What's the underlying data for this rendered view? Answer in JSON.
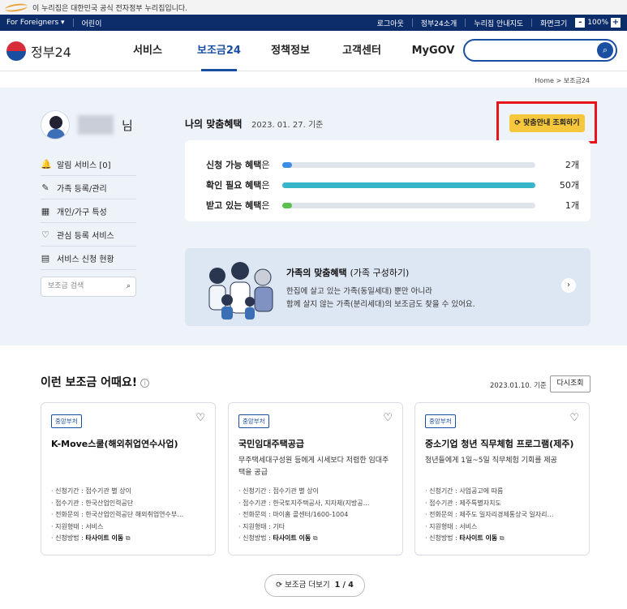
{
  "gov_banner": {
    "text": "이 누리집은 대한민국 공식 전자정부 누리집입니다."
  },
  "utility": {
    "language": "For Foreigners",
    "easy_mode": "어린이",
    "logout": "로그아웃",
    "about": "정부24소개",
    "sitemap": "누리집 안내지도",
    "zoom_label": "화면크기",
    "zoom_minus": "-",
    "zoom_value": "100%",
    "zoom_plus": "+"
  },
  "header": {
    "logo_text": "정부24",
    "nav": [
      "서비스",
      "보조금24",
      "정책정보",
      "고객센터",
      "MyGOV"
    ],
    "active_nav": "보조금24",
    "search_icon": "search-icon"
  },
  "breadcrumb": "Home  >  보조금24",
  "profile": {
    "suffix": "님"
  },
  "sidemenu": [
    {
      "icon": "bell-icon",
      "glyph": "🔔",
      "label": "알림 서비스 [0]"
    },
    {
      "icon": "pencil-icon",
      "glyph": "✎",
      "label": "가족 등록/관리"
    },
    {
      "icon": "calendar-icon",
      "glyph": "▦",
      "label": "개인/가구 특성"
    },
    {
      "icon": "heart-icon",
      "glyph": "♡",
      "label": "관심 등록 서비스"
    },
    {
      "icon": "document-icon",
      "glyph": "▤",
      "label": "서비스 신청 현황"
    }
  ],
  "side_search": {
    "placeholder": "보조금 검색"
  },
  "my_benefits": {
    "title": "나의 맞춤혜택",
    "date": "2023. 01. 27. 기준",
    "refresh_label": "맞춤안내 조회하기",
    "stats": [
      {
        "label": "신청 가능 혜택",
        "suffix": "은",
        "count": "2개",
        "value": 2,
        "max": 50,
        "color": "#3b8ee4"
      },
      {
        "label": "확인 필요 혜택",
        "suffix": "은",
        "count": "50개",
        "value": 50,
        "max": 50,
        "color": "#38b6c9"
      },
      {
        "label": "받고 있는 혜택",
        "suffix": "은",
        "count": "1개",
        "value": 1,
        "max": 50,
        "color": "#5cbf4e"
      }
    ]
  },
  "family": {
    "title": "가족의 맞춤혜택",
    "subtitle": "(가족 구성하기)",
    "desc_line1": "한집에 살고 있는 가족(동일세대) 뿐만 아니라",
    "desc_line2": "함께 살지 않는 가족(분리세대)의 보조금도 찾을 수 있어요."
  },
  "recommend": {
    "title": "이런 보조금 어때요!",
    "date": "2023.01.10. 기준",
    "reload": "다시조회",
    "cards": [
      {
        "badge": "중앙부처",
        "title": "K-Move스쿨(해외취업연수사업)",
        "desc": "",
        "meta": [
          "신청기간 : 접수기관 별 상이",
          "접수기관 : 한국산업인력공단",
          "전화문의 : 한국산업인력공단 해외취업연수부…",
          "지원형태 : 서비스"
        ],
        "method_label": "신청방법 : ",
        "method_value": "타사이트 이동"
      },
      {
        "badge": "중앙부처",
        "title": "국민임대주택공급",
        "desc": "무주택세대구성원 등에게 시세보다 저렴한 임대주택을 공급",
        "meta": [
          "신청기간 : 접수기관 별 상이",
          "접수기관 : 한국토지주택공사, 지자체(지방공…",
          "전화문의 : 마이홈 콜센터/1600-1004",
          "지원형태 : 기타"
        ],
        "method_label": "신청방법 : ",
        "method_value": "타사이트 이동"
      },
      {
        "badge": "중앙부처",
        "title": "중소기업 청년 직무체험 프로그램(제주)",
        "desc": "청년들에게 1일~5일 직무체험 기회를 제공",
        "meta": [
          "신청기간 : 사업공고에 따름",
          "접수기관 : 제주특별자치도",
          "전화문의 : 제주도 일자리경제통상국 일자리…",
          "지원형태 : 서비스"
        ],
        "method_label": "신청방법 : ",
        "method_value": "타사이트 이동"
      }
    ],
    "more_label": "보조금 더보기",
    "more_page": "1",
    "more_total": "4"
  }
}
